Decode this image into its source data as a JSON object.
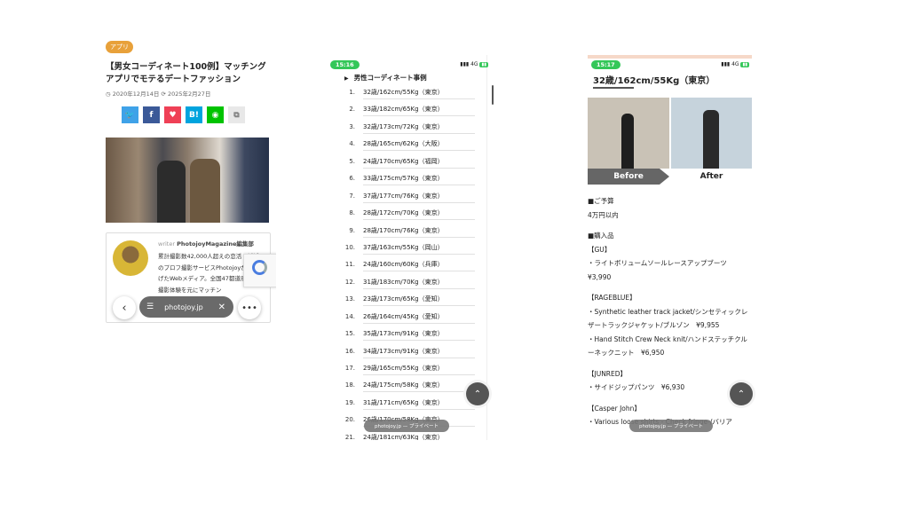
{
  "panel1": {
    "badge": "アプリ",
    "title": "【男女コーディネート100例】マッチングアプリでモテるデートファッション",
    "date_published": "2020年12月14日",
    "date_updated": "2025年2月27日",
    "share_buttons": [
      {
        "icon": "twitter-icon",
        "label": "",
        "color": "#3fa2e8"
      },
      {
        "icon": "facebook-icon",
        "label": "f",
        "color": "#3b5998"
      },
      {
        "icon": "pocket-icon",
        "label": "",
        "color": "#ef4056"
      },
      {
        "icon": "hatena-bookmark-icon",
        "label": "B!",
        "color": "#00a4de"
      },
      {
        "icon": "line-icon",
        "label": "",
        "color": "#00c300"
      },
      {
        "icon": "copy-icon",
        "label": "",
        "color": "#e8e8e8"
      }
    ],
    "writer_label": "writer",
    "writer_name": "PhotojoyMagazine編集部",
    "writer_text": "累計撮影数42,000人超えの恋活・婚活のプロフ撮影サービスPhotojoyが立ち上げたWebメディア。全国47都道府県での撮影体験を元にマッチン",
    "url": "photojoy.jp"
  },
  "panel2": {
    "time": "15:16",
    "network": "4G",
    "section_header": "男性コーディネート事例",
    "items": [
      {
        "n": "1.",
        "t": "32歳/162cm/55Kg（東京）"
      },
      {
        "n": "2.",
        "t": "33歳/182cm/65Kg（東京）"
      },
      {
        "n": "3.",
        "t": "32歳/173cm/72Kg（東京）"
      },
      {
        "n": "4.",
        "t": "28歳/165cm/62Kg（大阪）"
      },
      {
        "n": "5.",
        "t": "24歳/170cm/65Kg（福岡）"
      },
      {
        "n": "6.",
        "t": "33歳/175cm/57Kg（東京）"
      },
      {
        "n": "7.",
        "t": "37歳/177cm/76Kg（東京）"
      },
      {
        "n": "8.",
        "t": "28歳/172cm/70Kg（東京）"
      },
      {
        "n": "9.",
        "t": "28歳/170cm/76Kg（東京）"
      },
      {
        "n": "10.",
        "t": "37歳/163cm/55Kg（岡山）"
      },
      {
        "n": "11.",
        "t": "24歳/160cm/60Kg（兵庫）"
      },
      {
        "n": "12.",
        "t": "31歳/183cm/70Kg（東京）"
      },
      {
        "n": "13.",
        "t": "23歳/173cm/65Kg（愛知）"
      },
      {
        "n": "14.",
        "t": "26歳/164cm/45Kg（愛知）"
      },
      {
        "n": "15.",
        "t": "35歳/173cm/91Kg（東京）"
      },
      {
        "n": "16.",
        "t": "34歳/173cm/91Kg（東京）"
      },
      {
        "n": "17.",
        "t": "29歳/165cm/55Kg（東京）"
      },
      {
        "n": "18.",
        "t": "24歳/175cm/58Kg（東京）"
      },
      {
        "n": "19.",
        "t": "31歳/171cm/65Kg（東京）"
      },
      {
        "n": "20.",
        "t": "26歳/170cm/58Kg（東京）"
      },
      {
        "n": "21.",
        "t": "24歳/181cm/63Kg（東京）"
      }
    ],
    "bottom_url": "photojoy.jp — プライベート"
  },
  "panel3": {
    "time": "15:17",
    "network": "4G",
    "title": "32歳/162cm/55Kg（東京）",
    "before_label": "Before",
    "after_label": "After",
    "budget_heading": "■ご予算",
    "budget_value": "4万円以内",
    "purchase_heading": "■購入品",
    "gu_brand": "【GU】",
    "gu_item": "・ライトボリュームソールレースアップブーツ　¥3,990",
    "rageblue_brand": "【RAGEBLUE】",
    "rageblue_item1": "・Synthetic leather track jacket/シンセティックレザートラックジャケット/ブルゾン　¥9,955",
    "rageblue_item2": "・Hand Stitch Crew Neck knit/ハンドステッチクルーネックニット　¥6,950",
    "junred_brand": "【JUNRED】",
    "junred_item": "・サイドジップパンツ　¥6,930",
    "casper_brand": "【Casper John】",
    "casper_item": "・Various loose shirts - Check fringe-/バリア",
    "bottom_url": "photojoy.jp — プライベート"
  }
}
